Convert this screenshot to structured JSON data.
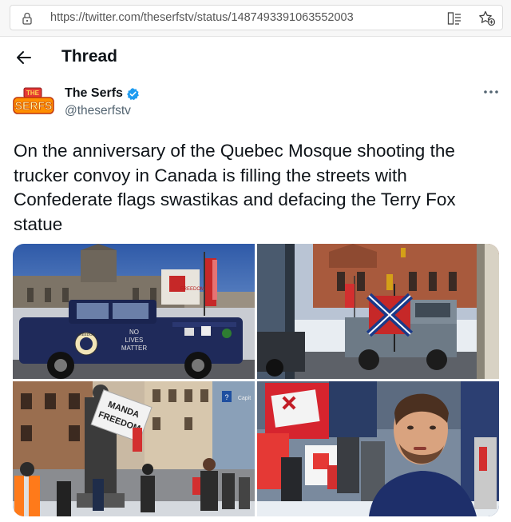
{
  "browser": {
    "url": "https://twitter.com/theserfstv/status/1487493391063552003",
    "icons": [
      "lock-icon",
      "reader-mode-icon",
      "add-favorite-icon"
    ]
  },
  "header": {
    "title": "Thread",
    "back_icon": "back-arrow-icon"
  },
  "tweet": {
    "author_name": "The Serfs",
    "author_handle": "@theserfstv",
    "avatar_text_top": "THE",
    "avatar_text_bottom": "SERFS",
    "verified_icon": "verified-badge-icon",
    "more_icon": "more-options-icon",
    "text": "On the anniversary of the Quebec Mosque shooting the trucker convoy in Canada is filling the streets with Confederate flags swastikas and defacing the Terry Fox statue"
  },
  "media": {
    "photo1": {
      "sign_top": "NO",
      "sign_mid": "LIVES",
      "sign_bot": "MATTER",
      "badge": "FREEDOM"
    },
    "photo2": {},
    "photo3": {
      "sign_line1": "MANDA",
      "sign_line2": "FREEDOM",
      "building_sign": "Capit"
    },
    "photo4": {}
  },
  "colors": {
    "verified": "#1d9bf0",
    "handle": "#536471",
    "text": "#0f1419"
  }
}
